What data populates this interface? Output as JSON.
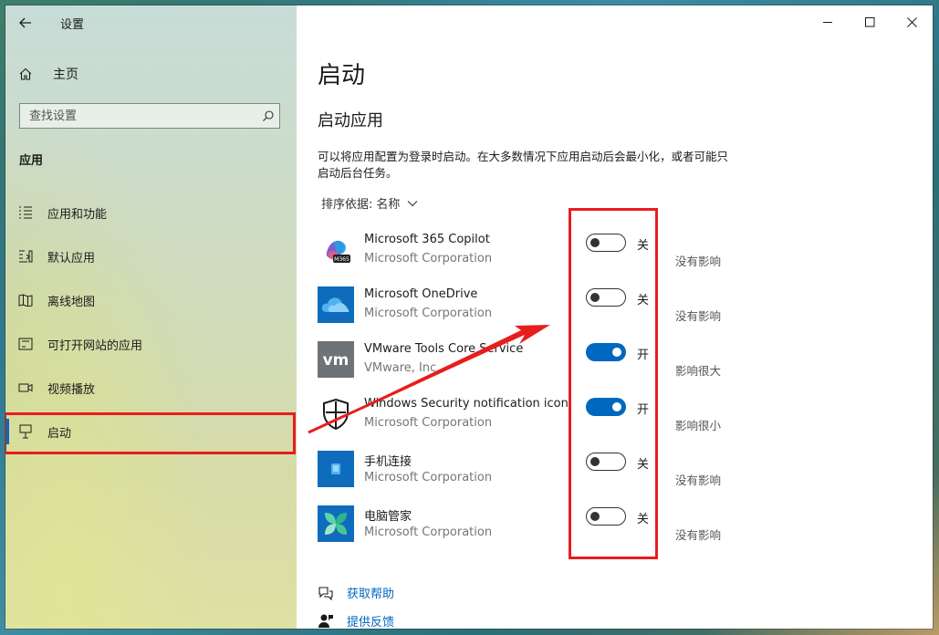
{
  "window": {
    "title": "设置"
  },
  "sidebar": {
    "home_label": "主页",
    "search_placeholder": "查找设置",
    "section_label": "应用",
    "items": [
      {
        "label": "应用和功能",
        "icon": "apps-features-icon"
      },
      {
        "label": "默认应用",
        "icon": "default-apps-icon"
      },
      {
        "label": "离线地图",
        "icon": "offline-maps-icon"
      },
      {
        "label": "可打开网站的应用",
        "icon": "apps-for-websites-icon"
      },
      {
        "label": "视频播放",
        "icon": "video-playback-icon"
      },
      {
        "label": "启动",
        "icon": "startup-icon",
        "active": true
      }
    ]
  },
  "main": {
    "title": "启动",
    "subtitle": "启动应用",
    "description": "可以将应用配置为登录时启动。在大多数情况下应用启动后会最小化，或者可能只启动后台任务。",
    "sort_label": "排序依据:",
    "sort_value": "名称",
    "apps": [
      {
        "name": "Microsoft 365 Copilot",
        "publisher": "Microsoft Corporation",
        "enabled": false,
        "state_label": "关",
        "impact": "没有影响"
      },
      {
        "name": "Microsoft OneDrive",
        "publisher": "Microsoft Corporation",
        "enabled": false,
        "state_label": "关",
        "impact": "没有影响"
      },
      {
        "name": "VMware Tools Core Service",
        "publisher": "VMware, Inc.",
        "enabled": true,
        "state_label": "开",
        "impact": "影响很大"
      },
      {
        "name": "Windows Security notification icon",
        "publisher": "Microsoft Corporation",
        "enabled": true,
        "state_label": "开",
        "impact": "影响很小"
      },
      {
        "name": "手机连接",
        "publisher": "Microsoft Corporation",
        "enabled": false,
        "state_label": "关",
        "impact": "没有影响"
      },
      {
        "name": "电脑管家",
        "publisher": "Microsoft Corporation",
        "enabled": false,
        "state_label": "关",
        "impact": "没有影响"
      }
    ],
    "help_label": "获取帮助",
    "feedback_label": "提供反馈"
  },
  "colors": {
    "accent": "#0067c0",
    "annotation_red": "#e81d1d"
  }
}
